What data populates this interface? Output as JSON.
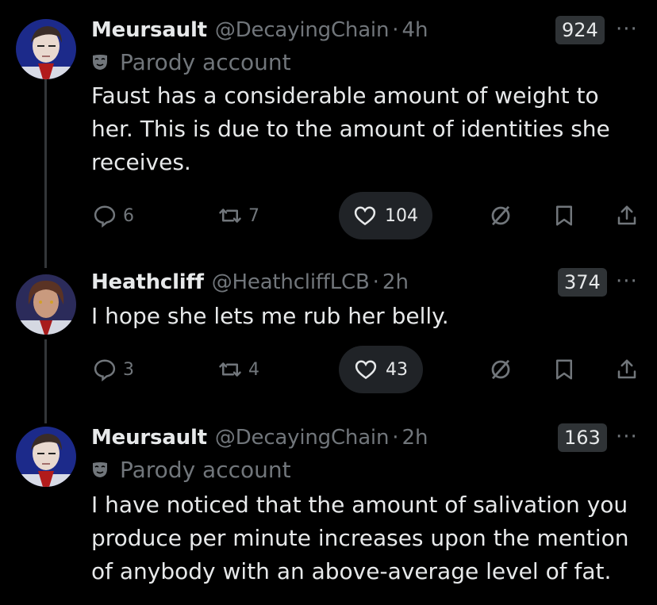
{
  "tweets": [
    {
      "name": "Meursault",
      "handle": "@DecayingChain",
      "separator": "·",
      "time": "4h",
      "views": "924",
      "more": "···",
      "parody_label": "Parody account",
      "text": "Faust has a considerable amount of weight to her. This is due to the amount of identities she receives.",
      "replies": "6",
      "reposts": "7",
      "likes": "104"
    },
    {
      "name": "Heathcliff",
      "handle": "@HeathcliffLCB",
      "separator": "·",
      "time": "2h",
      "views": "374",
      "more": "···",
      "text": "I hope she lets me rub her belly.",
      "replies": "3",
      "reposts": "4",
      "likes": "43"
    },
    {
      "name": "Meursault",
      "handle": "@DecayingChain",
      "separator": "·",
      "time": "2h",
      "views": "163",
      "more": "···",
      "parody_label": "Parody account",
      "text": "I have noticed that the amount of salivation you produce per minute increases upon the mention of anybody with an above-average level of fat."
    }
  ],
  "icons": {
    "reply": "reply-icon",
    "repost": "repost-icon",
    "like": "heart-icon",
    "grok": "grok-icon",
    "bookmark": "bookmark-icon",
    "share": "share-icon",
    "parody": "parody-mask-icon"
  },
  "colors": {
    "background": "#000000",
    "text": "#e7e9ea",
    "muted": "#71767b",
    "pill": "#202327",
    "badge": "#2f3336"
  }
}
